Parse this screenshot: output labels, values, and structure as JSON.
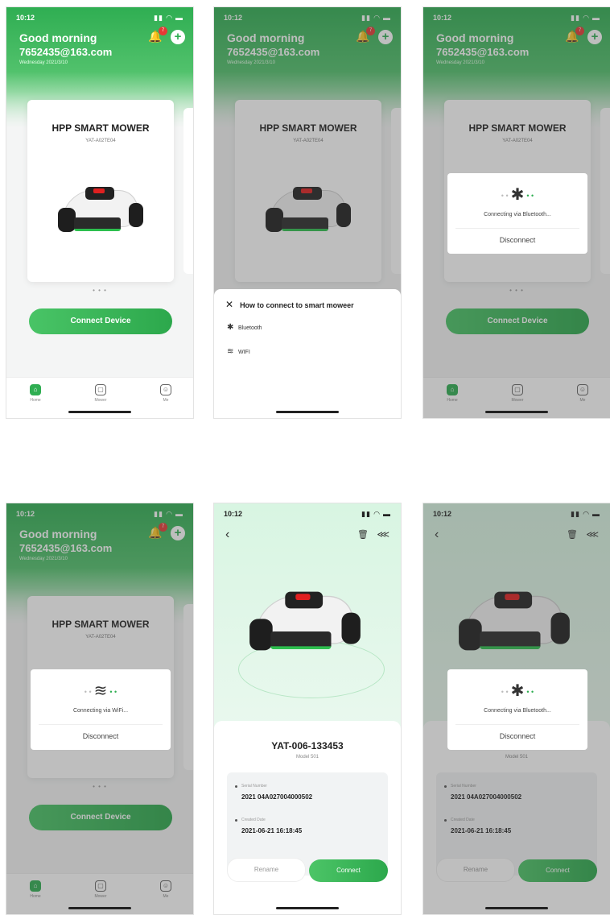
{
  "status": {
    "time": "10:12",
    "icons": "▮▮ ◠ ▬"
  },
  "home": {
    "greeting": "Good morning",
    "email": "7652435@163.com",
    "date": "Wednesday 2021/3/10",
    "notification_count": "7",
    "device_title": "HPP SMART MOWER",
    "device_model": "YAT-A02TE04",
    "pager": "• • •",
    "connect_button": "Connect Device",
    "tabs": [
      {
        "label": "Home",
        "icon": "⌂"
      },
      {
        "label": "Mower",
        "icon": "▢"
      },
      {
        "label": "Me",
        "icon": "☺"
      }
    ]
  },
  "sheet": {
    "close": "✕",
    "title": "How to connect to smart moweer",
    "options": [
      {
        "icon": "✱",
        "label": "Bluetooth"
      },
      {
        "icon": "≋",
        "label": "WIFI"
      }
    ]
  },
  "dialog_bt": {
    "icon": "✱",
    "text": "Connecting via Bluetooth...",
    "button": "Disconnect"
  },
  "dialog_wifi": {
    "icon": "≋",
    "text": "Connecting via WiFi...",
    "button": "Disconnect"
  },
  "detail": {
    "back": "‹",
    "trash": "🗑",
    "share": "⋘",
    "serial_title": "YAT-006-133453",
    "model": "Model 501",
    "serial_label": "Serial Number",
    "serial_value": "2021 04A027004000502",
    "created_label": "Created Date",
    "created_value": "2021-06-21 16:18:45",
    "rename_button": "Rename",
    "connect_button": "Connect"
  },
  "colors": {
    "brand_green": "#2fae52",
    "badge_red": "#e53935"
  }
}
